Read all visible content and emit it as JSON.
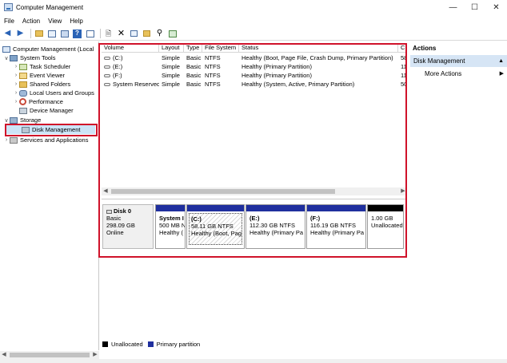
{
  "window": {
    "title": "Computer Management"
  },
  "window_controls": {
    "minimize": "—",
    "maximize": "☐",
    "close": "✕"
  },
  "menu": {
    "items": [
      "File",
      "Action",
      "View",
      "Help"
    ]
  },
  "toolbar": {
    "icons": [
      "back-arrow-icon",
      "forward-arrow-icon",
      "up-folder-icon",
      "show-hide-tree-icon",
      "properties-icon",
      "help-icon",
      "cut-icon",
      "delete-icon",
      "copy-icon",
      "paste-icon",
      "search-icon",
      "refresh-icon"
    ]
  },
  "tree": {
    "root": "Computer Management (Local",
    "system_tools": "System Tools",
    "task_scheduler": "Task Scheduler",
    "event_viewer": "Event Viewer",
    "shared_folders": "Shared Folders",
    "local_users": "Local Users and Groups",
    "performance": "Performance",
    "device_manager": "Device Manager",
    "storage": "Storage",
    "disk_management": "Disk Management",
    "services": "Services and Applications"
  },
  "volumes": {
    "headers": {
      "volume": "Volume",
      "layout": "Layout",
      "type": "Type",
      "fs": "File System",
      "status": "Status",
      "capacity": "C"
    },
    "rows": [
      {
        "volume": "(C:)",
        "layout": "Simple",
        "type": "Basic",
        "fs": "NTFS",
        "status": "Healthy (Boot, Page File, Crash Dump, Primary Partition)",
        "capacity": "58"
      },
      {
        "volume": "(E:)",
        "layout": "Simple",
        "type": "Basic",
        "fs": "NTFS",
        "status": "Healthy (Primary Partition)",
        "capacity": "11"
      },
      {
        "volume": "(F:)",
        "layout": "Simple",
        "type": "Basic",
        "fs": "NTFS",
        "status": "Healthy (Primary Partition)",
        "capacity": "11"
      },
      {
        "volume": "System Reserved",
        "layout": "Simple",
        "type": "Basic",
        "fs": "NTFS",
        "status": "Healthy (System, Active, Primary Partition)",
        "capacity": "50"
      }
    ]
  },
  "disk": {
    "name": "Disk 0",
    "type": "Basic",
    "size": "298.09 GB",
    "state": "Online",
    "partitions": [
      {
        "name": "System I",
        "size": "500 MB N",
        "status": "Healthy ("
      },
      {
        "name": "(C:)",
        "size": "58.11 GB NTFS",
        "status": "Healthy (Boot, Pag"
      },
      {
        "name": "(E:)",
        "size": "112.30 GB NTFS",
        "status": "Healthy (Primary Pa"
      },
      {
        "name": "(F:)",
        "size": "116.19 GB NTFS",
        "status": "Healthy (Primary Pa"
      },
      {
        "name": "",
        "size": "1.00 GB",
        "status": "Unallocated"
      }
    ]
  },
  "legend": {
    "unallocated": "Unallocated",
    "primary": "Primary partition"
  },
  "colors": {
    "primary_partition": "#1f2f9e",
    "unallocated": "#000000",
    "highlight": "#d0122a",
    "selection": "#cce4f7"
  },
  "actions": {
    "title": "Actions",
    "section": "Disk Management",
    "more": "More Actions"
  }
}
